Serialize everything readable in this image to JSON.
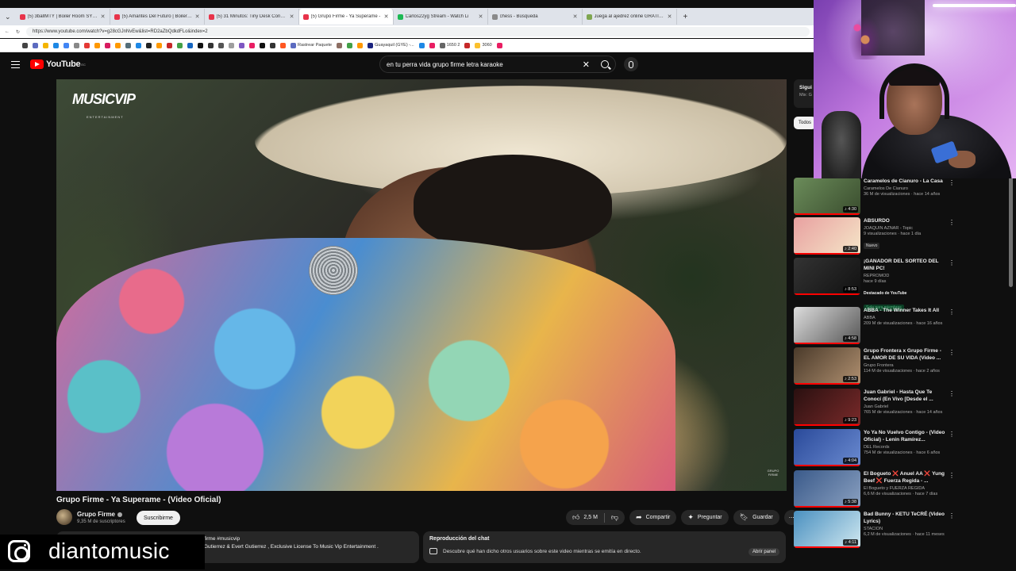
{
  "browser": {
    "tabs": [
      {
        "title": "(5) 3ballMTY | Boiler Room SYSTE",
        "color": "#e8334a"
      },
      {
        "title": "(5) Amantes Del Futuro | Boiler Ro",
        "color": "#e8334a"
      },
      {
        "title": "(5) 31 Minutos: Tiny Desk Concert",
        "color": "#e8334a"
      },
      {
        "title": "(5) Grupo Firme - Ya Superame -",
        "color": "#e8334a"
      },
      {
        "title": "Carlos22yg Stream - Watch Li",
        "color": "#1db954"
      },
      {
        "title": "chess - Búsqueda",
        "color": "#8a8a8a"
      },
      {
        "title": "Juega al ajedrez online GRATIS - A",
        "color": "#7fa650"
      }
    ],
    "active_tab_index": 3,
    "url": "https://www.youtube.com/watch?v=g28cGJnNvEw&list=RD2aZbQdkdFLo&index=2",
    "bookmarks": [
      {
        "label": "",
        "color": "#444"
      },
      {
        "label": "",
        "color": "#5c6bc0"
      },
      {
        "label": "",
        "color": "#f4b400"
      },
      {
        "label": "",
        "color": "#1e88e5"
      },
      {
        "label": "",
        "color": "#4285f4"
      },
      {
        "label": "",
        "color": "#888"
      },
      {
        "label": "",
        "color": "#e53935"
      },
      {
        "label": "",
        "color": "#ff9800"
      },
      {
        "label": "",
        "color": "#d81b60"
      },
      {
        "label": "",
        "color": "#ff9900"
      },
      {
        "label": "",
        "color": "#546e7a"
      },
      {
        "label": "",
        "color": "#1e88e5"
      },
      {
        "label": "",
        "color": "#222"
      },
      {
        "label": "",
        "color": "#ff9900"
      },
      {
        "label": "",
        "color": "#c62828"
      },
      {
        "label": "",
        "color": "#43a047"
      },
      {
        "label": "",
        "color": "#1565c0"
      },
      {
        "label": "",
        "color": "#111"
      },
      {
        "label": "",
        "color": "#333"
      },
      {
        "label": "",
        "color": "#555"
      },
      {
        "label": "",
        "color": "#9e9e9e"
      },
      {
        "label": "",
        "color": "#7e57c2"
      },
      {
        "label": "",
        "color": "#e91e63"
      },
      {
        "label": "",
        "color": "#111"
      },
      {
        "label": "",
        "color": "#333"
      },
      {
        "label": "",
        "color": "#ff5722"
      },
      {
        "label": "Rastrear Paquete",
        "color": "#5c6bc0"
      },
      {
        "label": "",
        "color": "#8d6e63"
      },
      {
        "label": "",
        "color": "#43a047"
      },
      {
        "label": "",
        "color": "#ff9800"
      },
      {
        "label": "Guayaquil (GYE) -...",
        "color": "#1a237e"
      },
      {
        "label": "",
        "color": "#1e88e5"
      },
      {
        "label": "",
        "color": "#e91e63"
      },
      {
        "label": "1650 2",
        "color": "#666"
      },
      {
        "label": "",
        "color": "#c62828"
      },
      {
        "label": "3060",
        "color": "#fbc02d"
      },
      {
        "label": "",
        "color": "#e91e63"
      }
    ]
  },
  "youtube": {
    "logo_text": "YouTube",
    "country": "EC",
    "search_value": "en tu perra vida grupo firme letra karaoke"
  },
  "video": {
    "overlay_logo": "MUSICVIP",
    "overlay_sub": "ENTERTAINMENT",
    "watermark": "GRUPO FIRME",
    "title": "Grupo Firme - Ya Superame - (Video Oficial)",
    "channel": "Grupo Firme",
    "subscribers": "9,35 M de suscriptores",
    "subscribe_label": "Suscribirme",
    "likes": "2,5 M",
    "share_label": "Compartir",
    "ask_label": "Preguntar",
    "save_label": "Guardar",
    "description_line1": "firme #musicvip",
    "description_line2": "Gutierrez & Evert Gutierrez , Exclusive License To Music Vip Entertainment ."
  },
  "chat_replay": {
    "title": "Reproducción del chat",
    "desc": "Descubre qué han dicho otros usuarios sobre este video mientras se emitía en directo.",
    "button": "Abrir panel"
  },
  "overlay": {
    "handle": "diantomusic"
  },
  "sidebar": {
    "next_label": "Sigui",
    "next_sub": "Mix: G",
    "chip": "Todos",
    "items": [
      {
        "title": "Caramelos de Cianuro - La Casa",
        "channel": "Caramelos De Cianuro",
        "views": "36 M de visualizaciones · hace 14 años",
        "duration": "4:30",
        "badge": "",
        "colors": [
          "#6b8c5a",
          "#3a4d2e"
        ]
      },
      {
        "title": "ABSURDO",
        "channel": "JOAQUIN AZNAR - Topic",
        "views": "9 visualizaciones · hace 1 día",
        "duration": "2:40",
        "badge": "Nuevo",
        "colors": [
          "#e8a0a0",
          "#f5e6c8"
        ]
      },
      {
        "title": "¡GANADOR DEL SORTEO DEL MINI PC!",
        "channel": "REPROMOD",
        "views": "hace 9 días",
        "duration": "8:53",
        "badge": "Destacado de YouTube",
        "badge2": "Solo para miembros",
        "colors": [
          "#333",
          "#111"
        ]
      },
      {
        "title": "ABBA - The Winner Takes It All",
        "channel": "ABBA",
        "views": "209 M de visualizaciones · hace 16 años",
        "duration": "4:58",
        "badge": "",
        "colors": [
          "#ddd",
          "#555"
        ]
      },
      {
        "title": "Grupo Frontera x Grupo Firme - EL AMOR DE SU VIDA (Video ...",
        "channel": "Grupo Frontera",
        "views": "114 M de visualizaciones · hace 2 años",
        "duration": "2:53",
        "badge": "",
        "colors": [
          "#4a3a2a",
          "#b09070"
        ]
      },
      {
        "title": "Juan Gabriel - Hasta Que Te Conocí (En Vivo [Desde el ...",
        "channel": "Juan Gabriel",
        "views": "765 M de visualizaciones · hace 14 años",
        "duration": "9:23",
        "badge": "",
        "colors": [
          "#2a1010",
          "#7a2a2a"
        ]
      },
      {
        "title": "Yo Ya No Vuelvo Contigo - (Video Oficial) - Lenin Ramírez...",
        "channel": "DEL Records",
        "views": "754 M de visualizaciones · hace 6 años",
        "duration": "4:04",
        "badge": "",
        "colors": [
          "#2a4a9a",
          "#6a8ad0"
        ]
      },
      {
        "title": "El Bogueto ❌ Anuel AA ❌ Yung Beef ❌ Fuerza Regida - ...",
        "channel": "El Bogueto y FUERZA REGIDA",
        "views": "6,6 M de visualizaciones · hace 7 días",
        "duration": "5:38",
        "badge": "",
        "colors": [
          "#3a5a8a",
          "#8aa0c0"
        ]
      },
      {
        "title": "Bad Bunny - KETU TeCRÉ (Video Lyrics)",
        "channel": "STACION",
        "views": "6,2 M de visualizaciones · hace 11 meses",
        "duration": "4:11",
        "badge": "",
        "colors": [
          "#4a90c0",
          "#d0e8f0"
        ]
      }
    ]
  }
}
